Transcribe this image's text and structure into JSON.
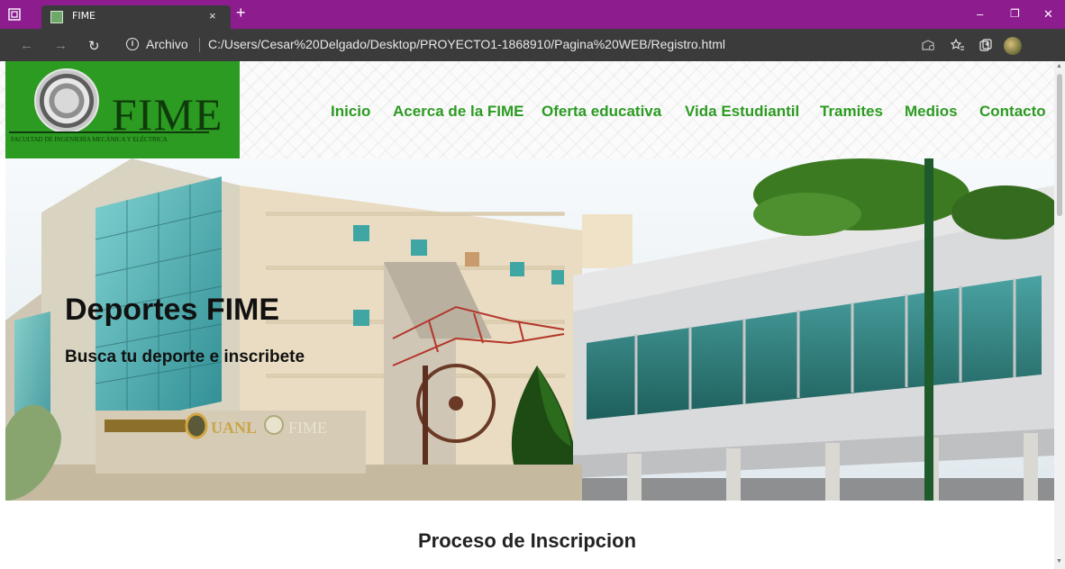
{
  "browser": {
    "tab_title": "FIME",
    "tab_close": "×",
    "new_tab": "+",
    "window_controls": {
      "minimize": "–",
      "restore": "❐",
      "close": "✕"
    },
    "nav": {
      "back": "←",
      "forward": "→",
      "refresh": "↻"
    },
    "address": {
      "info_icon": "i",
      "scheme_label": "Archivo",
      "url": "C:/Users/Cesar%20Delgado/Desktop/PROYECTO1-1868910/Pagina%20WEB/Registro.html"
    },
    "more": "···",
    "colors": {
      "tabbar": "#8d1c8f",
      "toolbar": "#3b3b3b"
    }
  },
  "site": {
    "logo": {
      "wordmark": "FIME",
      "subtitle": "FACULTAD DE INGENIERÍA MECÁNICA Y ELÉCTRICA"
    },
    "nav_items": [
      {
        "label": "Inicio"
      },
      {
        "label": "Acerca de la FIME"
      },
      {
        "label": "Oferta educativa"
      },
      {
        "label": "Vida Estudiantil"
      },
      {
        "label": "Tramites"
      },
      {
        "label": "Medios"
      },
      {
        "label": "Contacto"
      }
    ],
    "hero": {
      "title": "Deportes FIME",
      "subtitle": "Busca tu deporte e inscribete",
      "signage": {
        "uanl": "UANL",
        "fime": "FIME"
      }
    },
    "section_title": "Proceso de Inscripcion",
    "colors": {
      "brand_green": "#2c9b22",
      "logo_dark": "#0f3b0c"
    }
  },
  "scrollbar": {
    "up": "▲",
    "down": "▼"
  }
}
